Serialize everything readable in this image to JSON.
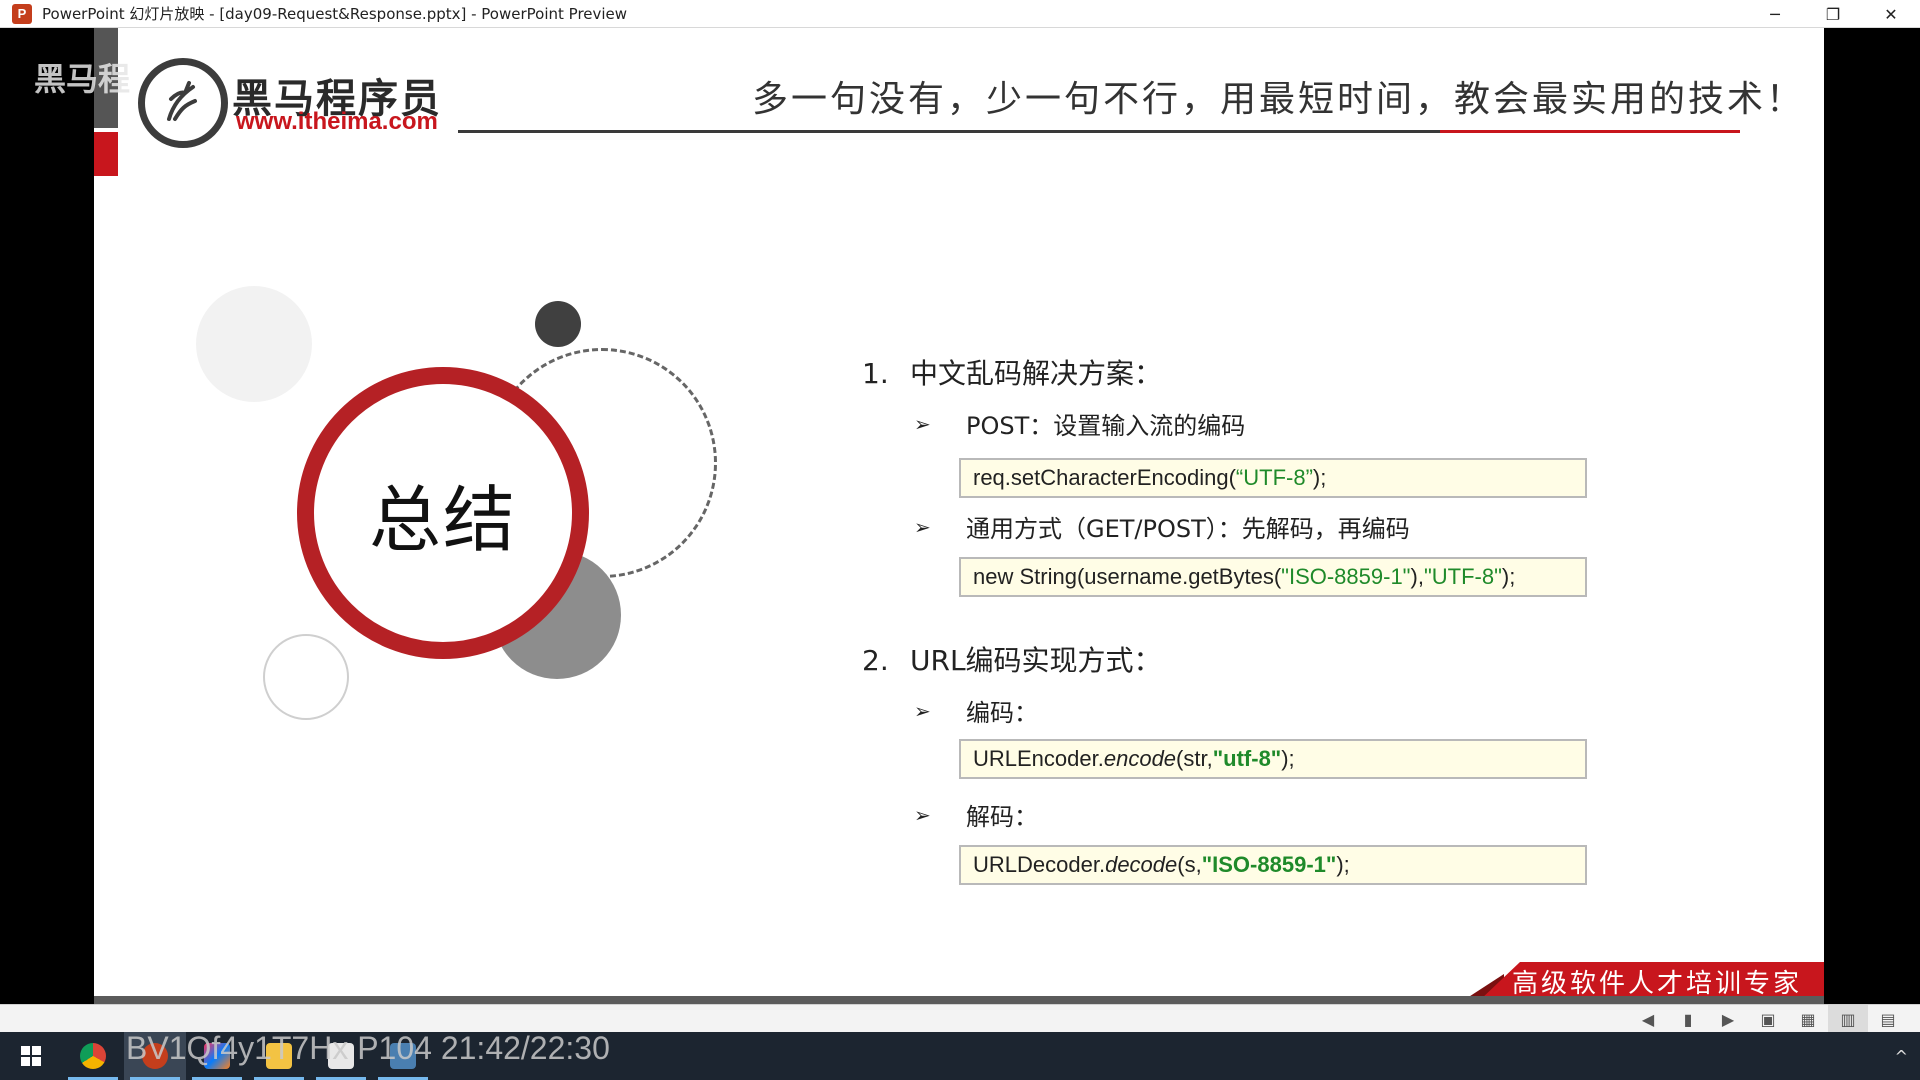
{
  "window": {
    "app_icon": "P",
    "title": "PowerPoint 幻灯片放映 - [day09-Request&Response.pptx] - PowerPoint Preview",
    "minimize": "─",
    "restore": "❐",
    "close": "✕"
  },
  "slide": {
    "logo_text": "黑马程序员",
    "logo_url": "www.itheima.com",
    "slogan": "多一句没有，少一句不行，用最短时间，教会最实用的技术！",
    "summary_title": "总结",
    "items": [
      {
        "num": "1.",
        "heading": "中文乱码解决方案：",
        "subs": [
          {
            "label": "POST：设置输入流的编码",
            "code": {
              "pre": "req.setCharacterEncoding(",
              "str": "“UTF-8”",
              "post": ");"
            }
          },
          {
            "label": "通用方式（GET/POST）：先解码，再编码",
            "code": {
              "pre": "new String(username.getBytes(",
              "str1": "\"ISO-8859-1\"",
              "mid": "),",
              "str2": "\"UTF-8\"",
              "post": ");"
            }
          }
        ]
      },
      {
        "num": "2.",
        "heading": "URL编码实现方式：",
        "subs": [
          {
            "label": "编码：",
            "code": {
              "pre": "URLEncoder.",
              "method": "encode",
              "args": "(str, ",
              "str": "\"utf-8\"",
              "post": ");"
            }
          },
          {
            "label": "解码：",
            "code": {
              "pre": "URLDecoder.",
              "method": "decode",
              "args": "(s, ",
              "str": "\"ISO-8859-1\"",
              "post": ");"
            }
          }
        ]
      }
    ],
    "bullet_arrow": "➢",
    "ribbon_text": "高级软件人才培训专家"
  },
  "overlay": {
    "top_watermark": "黑马程",
    "video_id": "BV1Qf4y1T7Hx P104 21:42/22:30"
  },
  "viewer": {
    "buttons": [
      "◀",
      "▮",
      "▶",
      "▣",
      "▦",
      "▥",
      "▤"
    ]
  },
  "colors": {
    "accent_red": "#c8161d",
    "code_string_green": "#1f8a2a",
    "code_bg": "#fffde6"
  },
  "taskbar": {
    "tray_chevron": "^"
  }
}
